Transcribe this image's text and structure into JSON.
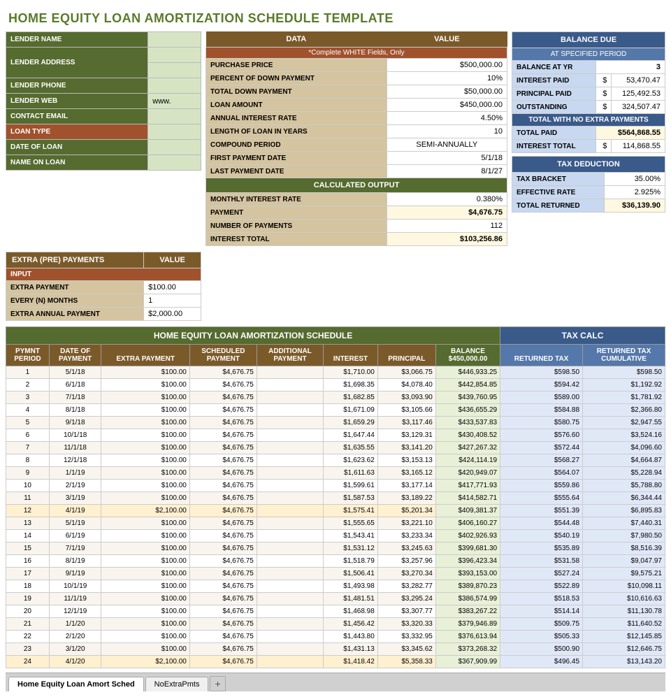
{
  "title": "HOME EQUITY LOAN AMORTIZATION SCHEDULE TEMPLATE",
  "lender": {
    "fields": [
      {
        "label": "LENDER NAME",
        "value": ""
      },
      {
        "label": "LENDER ADDRESS",
        "value": "",
        "rowspan": 2
      },
      {
        "label": "",
        "value": ""
      },
      {
        "label": "LENDER PHONE",
        "value": ""
      },
      {
        "label": "LENDER WEB",
        "value": "www."
      },
      {
        "label": "CONTACT EMAIL",
        "value": ""
      },
      {
        "label": "LOAN TYPE",
        "value": ""
      },
      {
        "label": "DATE OF LOAN",
        "value": ""
      },
      {
        "label": "NAME ON LOAN",
        "value": ""
      }
    ]
  },
  "data_table": {
    "header1": "DATA",
    "header2": "VALUE",
    "subheader": "*Complete WHITE Fields, Only",
    "rows": [
      {
        "label": "PURCHASE PRICE",
        "value": "$500,000.00"
      },
      {
        "label": "PERCENT OF DOWN PAYMENT",
        "value": "10%"
      },
      {
        "label": "TOTAL DOWN PAYMENT",
        "value": "$50,000.00"
      },
      {
        "label": "LOAN AMOUNT",
        "value": "$450,000.00"
      },
      {
        "label": "ANNUAL INTEREST RATE",
        "value": "4.50%"
      },
      {
        "label": "LENGTH OF LOAN IN YEARS",
        "value": "10"
      },
      {
        "label": "COMPOUND PERIOD",
        "value": "SEMI-ANNUALLY"
      },
      {
        "label": "FIRST PAYMENT DATE",
        "value": "5/1/18"
      },
      {
        "label": "LAST PAYMENT DATE",
        "value": "8/1/27"
      }
    ],
    "calc_header": "CALCULATED OUTPUT",
    "calc_rows": [
      {
        "label": "MONTHLY INTEREST RATE",
        "value": "0.380%"
      },
      {
        "label": "PAYMENT",
        "value": "$4,676.75",
        "bold": true
      },
      {
        "label": "NUMBER OF PAYMENTS",
        "value": "112"
      },
      {
        "label": "INTEREST TOTAL",
        "value": "$103,256.86",
        "bold": true
      }
    ]
  },
  "balance_due": {
    "title": "BALANCE DUE",
    "subtitle": "AT SPECIFIED PERIOD",
    "balance_yr_label": "BALANCE AT YR",
    "balance_yr_value": "3",
    "rows": [
      {
        "label": "INTEREST PAID",
        "symbol": "$",
        "value": "53,470.47"
      },
      {
        "label": "PRINCIPAL PAID",
        "symbol": "$",
        "value": "125,492.53"
      },
      {
        "label": "OUTSTANDING",
        "symbol": "$",
        "value": "324,507.47"
      }
    ],
    "total_header": "TOTAL WITH NO EXTRA PAYMENTS",
    "total_paid_label": "TOTAL PAID",
    "total_paid_value": "$564,868.55",
    "interest_total_label": "INTEREST TOTAL",
    "interest_total_symbol": "$",
    "interest_total_value": "114,868.55"
  },
  "tax_deduction": {
    "title": "TAX DEDUCTION",
    "rows": [
      {
        "label": "TAX BRACKET",
        "value": "35.00%"
      },
      {
        "label": "EFFECTIVE RATE",
        "value": "2.925%"
      }
    ],
    "total_label": "TOTAL RETURNED",
    "total_value": "$36,139.90"
  },
  "extra_payments": {
    "title": "EXTRA (PRE) PAYMENTS",
    "value_label": "VALUE",
    "input_label": "INPUT",
    "rows": [
      {
        "label": "EXTRA PAYMENT",
        "value": "$100.00"
      },
      {
        "label": "EVERY (N) MONTHS",
        "value": "1"
      },
      {
        "label": "EXTRA ANNUAL PAYMENT",
        "value": "$2,000.00"
      }
    ]
  },
  "amort_header": "HOME EQUITY LOAN AMORTIZATION SCHEDULE",
  "tax_calc_header": "TAX CALC",
  "amort_columns": [
    "PYMNT\nPERIOD",
    "DATE OF\nPAYMENT",
    "EXTRA PAYMENT",
    "SCHEDULED\nPAYMENT",
    "ADDITIONAL\nPAYMENT",
    "INTEREST",
    "PRINCIPAL",
    "BALANCE\n$450,000.00"
  ],
  "tax_columns": [
    "RETURNED TAX",
    "RETURNED TAX\nCUMULATIVE"
  ],
  "amort_rows": [
    {
      "period": "1",
      "date": "5/1/18",
      "extra": "$100.00",
      "scheduled": "$4,676.75",
      "additional": "",
      "interest": "$1,710.00",
      "principal": "$3,066.75",
      "balance": "$446,933.25",
      "ret_tax": "$598.50",
      "ret_cum": "$598.50"
    },
    {
      "period": "2",
      "date": "6/1/18",
      "extra": "$100.00",
      "scheduled": "$4,676.75",
      "additional": "",
      "interest": "$1,698.35",
      "principal": "$4,078.40",
      "balance": "$442,854.85",
      "ret_tax": "$594.42",
      "ret_cum": "$1,192.92"
    },
    {
      "period": "3",
      "date": "7/1/18",
      "extra": "$100.00",
      "scheduled": "$4,676.75",
      "additional": "",
      "interest": "$1,682.85",
      "principal": "$3,093.90",
      "balance": "$439,760.95",
      "ret_tax": "$589.00",
      "ret_cum": "$1,781.92"
    },
    {
      "period": "4",
      "date": "8/1/18",
      "extra": "$100.00",
      "scheduled": "$4,676.75",
      "additional": "",
      "interest": "$1,671.09",
      "principal": "$3,105.66",
      "balance": "$436,655.29",
      "ret_tax": "$584.88",
      "ret_cum": "$2,366.80"
    },
    {
      "period": "5",
      "date": "9/1/18",
      "extra": "$100.00",
      "scheduled": "$4,676.75",
      "additional": "",
      "interest": "$1,659.29",
      "principal": "$3,117.46",
      "balance": "$433,537.83",
      "ret_tax": "$580.75",
      "ret_cum": "$2,947.55"
    },
    {
      "period": "6",
      "date": "10/1/18",
      "extra": "$100.00",
      "scheduled": "$4,676.75",
      "additional": "",
      "interest": "$1,647.44",
      "principal": "$3,129.31",
      "balance": "$430,408.52",
      "ret_tax": "$576.60",
      "ret_cum": "$3,524.16"
    },
    {
      "period": "7",
      "date": "11/1/18",
      "extra": "$100.00",
      "scheduled": "$4,676.75",
      "additional": "",
      "interest": "$1,635.55",
      "principal": "$3,141.20",
      "balance": "$427,267.32",
      "ret_tax": "$572.44",
      "ret_cum": "$4,096.60"
    },
    {
      "period": "8",
      "date": "12/1/18",
      "extra": "$100.00",
      "scheduled": "$4,676.75",
      "additional": "",
      "interest": "$1,623.62",
      "principal": "$3,153.13",
      "balance": "$424,114.19",
      "ret_tax": "$568.27",
      "ret_cum": "$4,664.87"
    },
    {
      "period": "9",
      "date": "1/1/19",
      "extra": "$100.00",
      "scheduled": "$4,676.75",
      "additional": "",
      "interest": "$1,611.63",
      "principal": "$3,165.12",
      "balance": "$420,949.07",
      "ret_tax": "$564.07",
      "ret_cum": "$5,228.94"
    },
    {
      "period": "10",
      "date": "2/1/19",
      "extra": "$100.00",
      "scheduled": "$4,676.75",
      "additional": "",
      "interest": "$1,599.61",
      "principal": "$3,177.14",
      "balance": "$417,771.93",
      "ret_tax": "$559.86",
      "ret_cum": "$5,788.80"
    },
    {
      "period": "11",
      "date": "3/1/19",
      "extra": "$100.00",
      "scheduled": "$4,676.75",
      "additional": "",
      "interest": "$1,587.53",
      "principal": "$3,189.22",
      "balance": "$414,582.71",
      "ret_tax": "$555.64",
      "ret_cum": "$6,344.44"
    },
    {
      "period": "12",
      "date": "4/1/19",
      "extra": "$2,100.00",
      "scheduled": "$4,676.75",
      "additional": "",
      "interest": "$1,575.41",
      "principal": "$5,201.34",
      "balance": "$409,381.37",
      "ret_tax": "$551.39",
      "ret_cum": "$6,895.83"
    },
    {
      "period": "13",
      "date": "5/1/19",
      "extra": "$100.00",
      "scheduled": "$4,676.75",
      "additional": "",
      "interest": "$1,555.65",
      "principal": "$3,221.10",
      "balance": "$406,160.27",
      "ret_tax": "$544.48",
      "ret_cum": "$7,440.31"
    },
    {
      "period": "14",
      "date": "6/1/19",
      "extra": "$100.00",
      "scheduled": "$4,676.75",
      "additional": "",
      "interest": "$1,543.41",
      "principal": "$3,233.34",
      "balance": "$402,926.93",
      "ret_tax": "$540.19",
      "ret_cum": "$7,980.50"
    },
    {
      "period": "15",
      "date": "7/1/19",
      "extra": "$100.00",
      "scheduled": "$4,676.75",
      "additional": "",
      "interest": "$1,531.12",
      "principal": "$3,245.63",
      "balance": "$399,681.30",
      "ret_tax": "$535.89",
      "ret_cum": "$8,516.39"
    },
    {
      "period": "16",
      "date": "8/1/19",
      "extra": "$100.00",
      "scheduled": "$4,676.75",
      "additional": "",
      "interest": "$1,518.79",
      "principal": "$3,257.96",
      "balance": "$396,423.34",
      "ret_tax": "$531.58",
      "ret_cum": "$9,047.97"
    },
    {
      "period": "17",
      "date": "9/1/19",
      "extra": "$100.00",
      "scheduled": "$4,676.75",
      "additional": "",
      "interest": "$1,506.41",
      "principal": "$3,270.34",
      "balance": "$393,153.00",
      "ret_tax": "$527.24",
      "ret_cum": "$9,575.21"
    },
    {
      "period": "18",
      "date": "10/1/19",
      "extra": "$100.00",
      "scheduled": "$4,676.75",
      "additional": "",
      "interest": "$1,493.98",
      "principal": "$3,282.77",
      "balance": "$389,870.23",
      "ret_tax": "$522.89",
      "ret_cum": "$10,098.11"
    },
    {
      "period": "19",
      "date": "11/1/19",
      "extra": "$100.00",
      "scheduled": "$4,676.75",
      "additional": "",
      "interest": "$1,481.51",
      "principal": "$3,295.24",
      "balance": "$386,574.99",
      "ret_tax": "$518.53",
      "ret_cum": "$10,616.63"
    },
    {
      "period": "20",
      "date": "12/1/19",
      "extra": "$100.00",
      "scheduled": "$4,676.75",
      "additional": "",
      "interest": "$1,468.98",
      "principal": "$3,307.77",
      "balance": "$383,267.22",
      "ret_tax": "$514.14",
      "ret_cum": "$11,130.78"
    },
    {
      "period": "21",
      "date": "1/1/20",
      "extra": "$100.00",
      "scheduled": "$4,676.75",
      "additional": "",
      "interest": "$1,456.42",
      "principal": "$3,320.33",
      "balance": "$379,946.89",
      "ret_tax": "$509.75",
      "ret_cum": "$11,640.52"
    },
    {
      "period": "22",
      "date": "2/1/20",
      "extra": "$100.00",
      "scheduled": "$4,676.75",
      "additional": "",
      "interest": "$1,443.80",
      "principal": "$3,332.95",
      "balance": "$376,613.94",
      "ret_tax": "$505.33",
      "ret_cum": "$12,145.85"
    },
    {
      "period": "23",
      "date": "3/1/20",
      "extra": "$100.00",
      "scheduled": "$4,676.75",
      "additional": "",
      "interest": "$1,431.13",
      "principal": "$3,345.62",
      "balance": "$373,268.32",
      "ret_tax": "$500.90",
      "ret_cum": "$12,646.75"
    },
    {
      "period": "24",
      "date": "4/1/20",
      "extra": "$2,100.00",
      "scheduled": "$4,676.75",
      "additional": "",
      "interest": "$1,418.42",
      "principal": "$5,358.33",
      "balance": "$367,909.99",
      "ret_tax": "$496.45",
      "ret_cum": "$13,143.20"
    }
  ],
  "tabs": [
    {
      "label": "Home Equity Loan Amort Sched",
      "active": true
    },
    {
      "label": "NoExtraPmts",
      "active": false
    }
  ],
  "tab_add": "+"
}
